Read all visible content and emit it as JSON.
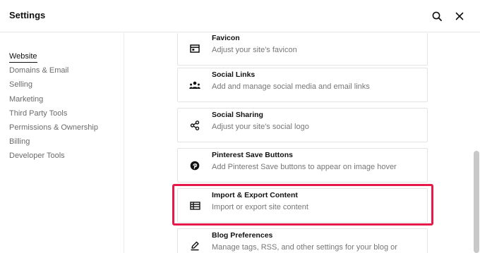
{
  "header": {
    "title": "Settings"
  },
  "sidebar": {
    "items": [
      {
        "label": "Website",
        "active": true
      },
      {
        "label": "Domains & Email",
        "active": false
      },
      {
        "label": "Selling",
        "active": false
      },
      {
        "label": "Marketing",
        "active": false
      },
      {
        "label": "Third Party Tools",
        "active": false
      },
      {
        "label": "Permissions & Ownership",
        "active": false
      },
      {
        "label": "Billing",
        "active": false
      },
      {
        "label": "Developer Tools",
        "active": false
      }
    ]
  },
  "cards": [
    {
      "title": "Favicon",
      "desc": "Adjust your site's favicon",
      "icon": "favicon-icon"
    },
    {
      "title": "Social Links",
      "desc": "Add and manage social media and email links",
      "icon": "people-icon"
    },
    {
      "title": "Social Sharing",
      "desc": "Adjust your site's social logo",
      "icon": "share-icon"
    },
    {
      "title": "Pinterest Save Buttons",
      "desc": "Add Pinterest Save buttons to appear on image hover",
      "icon": "pinterest-icon"
    },
    {
      "title": "Import & Export Content",
      "desc": "Import or export site content",
      "icon": "table-icon"
    },
    {
      "title": "Blog Preferences",
      "desc": "Manage tags, RSS, and other settings for your blog or",
      "icon": "blog-edit-icon"
    }
  ],
  "colors": {
    "highlight": "#e5194a",
    "text": "#111111",
    "muted": "#777777"
  }
}
